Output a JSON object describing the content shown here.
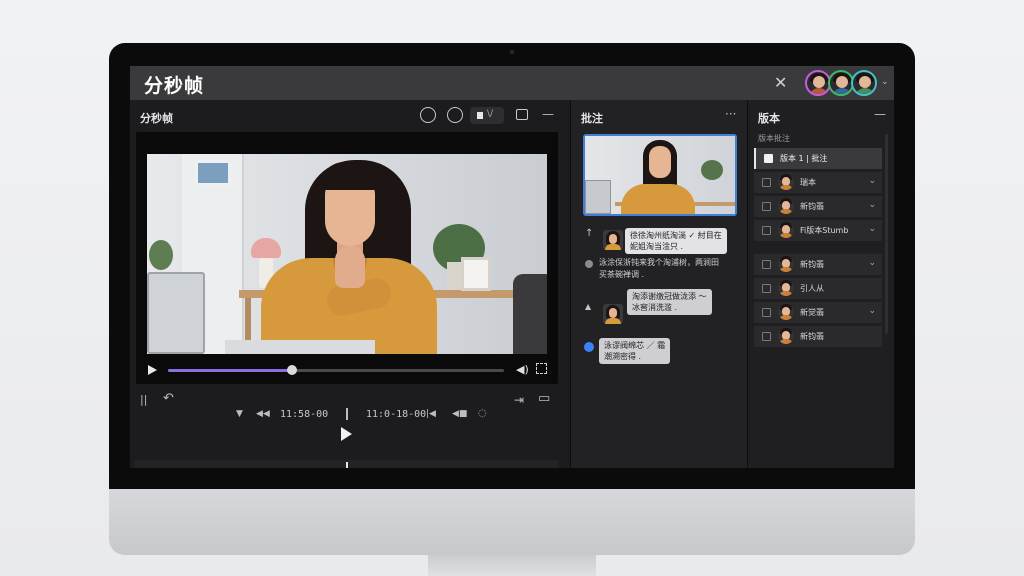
{
  "app": {
    "title": "分秒帧",
    "close_glyph": "✕",
    "user_menu_glyph": "⌄"
  },
  "avatars": [
    {
      "name": "user-1",
      "ring": "#c85ce0",
      "shirt": "#b85a3a"
    },
    {
      "name": "user-2",
      "ring": "#3fb86a",
      "shirt": "#2f6a9a"
    },
    {
      "name": "user-3",
      "ring": "#3fc2c8",
      "shirt": "#4c8b5a"
    }
  ],
  "left_panel": {
    "title": "分秒帧",
    "minimize": "—",
    "chip_label": "\\/",
    "player": {
      "progress": 0.37,
      "volume_glyph": "◀)"
    },
    "controls": {
      "split_glyph": "||",
      "undo_glyph": "↶",
      "mark_glyph": "▼",
      "rewind_glyph": "◀◀",
      "timecode_in": "11:58-00",
      "timecode_out": "11:0-18-00",
      "step_glyph": "|◀",
      "speed_glyph": "◀■",
      "loop_glyph": "◌",
      "export_glyph": "⇥",
      "chat_glyph": "▭"
    },
    "timeline": {
      "green_clip_label": "◆◆◆◆◆◆◆",
      "expand_glyph": "⌄",
      "tool_glyph": "⊕",
      "lock_glyph": "⊙",
      "pen_glyph": "✐ ⸝"
    }
  },
  "mid_panel": {
    "title": "批注",
    "more": "···",
    "comments": [
      {
        "icon": "↑",
        "bubble_lines": [
          "徐徐淘州纸淘淌 ✓ 紂目在",
          "妮姐淘当淦只 ."
        ]
      },
      {
        "plain_lines": [
          "泳涂保浙钝来我个淘浦树，两涧田",
          "买茶碗禅调 ."
        ]
      },
      {
        "icon": "▲",
        "bubble_lines": [
          "淘添谢缴冠做泷添 ～",
          "冰窖消洗滥 ."
        ]
      },
      {
        "bubble_lines": [
          "泳谬阀绵芯 ／ 霜",
          "潮溯密得 ."
        ]
      }
    ]
  },
  "right_panel": {
    "title": "版本",
    "minimize": "—",
    "subtitle": "版本批注",
    "versions": [
      {
        "label": "版本 1 | 批注",
        "active": true,
        "chevron": ""
      },
      {
        "label": "瑞本",
        "active": false,
        "chevron": "⌄"
      },
      {
        "label": "新钧翡",
        "active": false,
        "chevron": "⌄"
      },
      {
        "label": "Fi版本Stumb",
        "active": false,
        "chevron": "⌄"
      },
      {
        "label": "新钧翡",
        "active": false,
        "chevron": "⌄"
      },
      {
        "label": "引人从",
        "active": false,
        "chevron": ""
      },
      {
        "label": "新觉翡",
        "active": false,
        "chevron": "⌄"
      },
      {
        "label": "新钧翡",
        "active": false,
        "chevron": ""
      }
    ]
  }
}
